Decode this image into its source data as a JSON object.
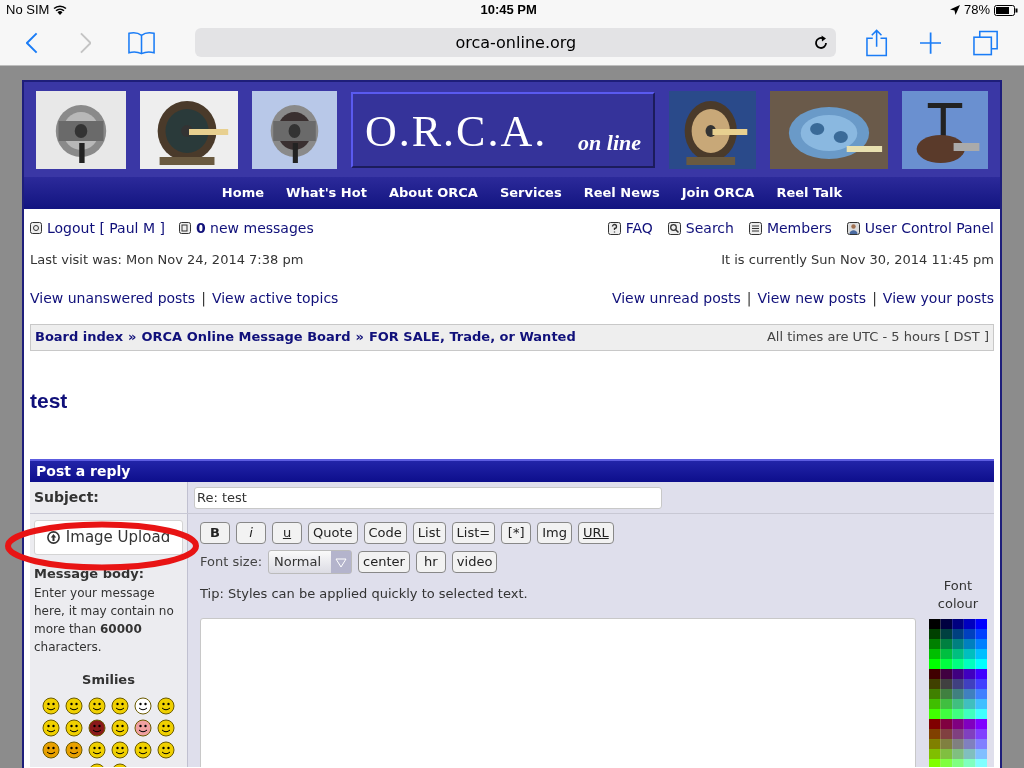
{
  "status_bar": {
    "carrier": "No SIM",
    "time": "10:45 PM",
    "battery": "78%"
  },
  "browser": {
    "url": "orca-online.org"
  },
  "logo": {
    "title": "O.R.C.A.",
    "tagline": "on line"
  },
  "nav": [
    "Home",
    "What's Hot",
    "About ORCA",
    "Services",
    "Reel News",
    "Join ORCA",
    "Reel Talk"
  ],
  "user_bar": {
    "logout": "Logout [ Paul M ]",
    "messages": "**0** new messages",
    "links": [
      {
        "kind": "faq",
        "label": "FAQ"
      },
      {
        "kind": "search",
        "label": "Search"
      },
      {
        "kind": "members",
        "label": "Members"
      },
      {
        "kind": "ucp",
        "label": "User Control Panel"
      }
    ]
  },
  "last_visit": "Last visit was: Mon Nov 24, 2014 7:38 pm",
  "current_time": "It is currently Sun Nov 30, 2014 11:45 pm",
  "link_separator": "|",
  "left_links": [
    "View unanswered posts",
    "View active topics"
  ],
  "right_links": [
    "View unread posts",
    "View new posts",
    "View your posts"
  ],
  "breadcrumbs": [
    "Board index",
    "ORCA Online Message Board",
    "FOR SALE, Trade, or Wanted"
  ],
  "breadcrumb_separator": "»",
  "timezone": "All times are UTC - 5 hours [ DST ]",
  "topic_title": "test",
  "post_form": {
    "header": "Post a reply",
    "subject_label": "Subject:",
    "subject_value": "Re: test",
    "upload_button": "Image Upload",
    "body_label": "Message body:",
    "body_hint": "Enter your message here, it may contain no more than **60000** characters.",
    "smilies_title": "Smilies",
    "format_buttons": [
      {
        "label": "B",
        "kind": "bold"
      },
      {
        "label": "i",
        "kind": "italic"
      },
      {
        "label": "u",
        "kind": "underline"
      },
      {
        "label": "Quote",
        "kind": "plain"
      },
      {
        "label": "Code",
        "kind": "plain"
      },
      {
        "label": "List",
        "kind": "plain"
      },
      {
        "label": "List=",
        "kind": "plain"
      },
      {
        "label": "[*]",
        "kind": "plain"
      },
      {
        "label": "Img",
        "kind": "plain"
      },
      {
        "label": "URL",
        "kind": "underline"
      },
      {
        "label": "center",
        "kind": "plain"
      },
      {
        "label": "hr",
        "kind": "plain"
      },
      {
        "label": "video",
        "kind": "plain"
      }
    ],
    "font_size_label": "Font size:",
    "font_size": "Normal",
    "tip": "Tip: Styles can be applied quickly to selected text.",
    "font_colour_title": "Font colour"
  }
}
